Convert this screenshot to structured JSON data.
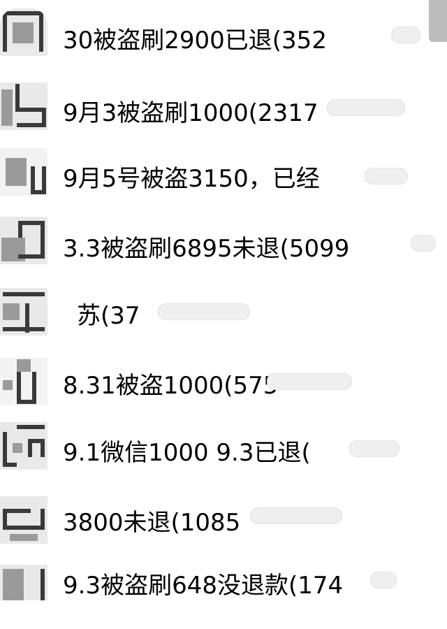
{
  "contacts": [
    {
      "name": "30被盗刷2900已退(352"
    },
    {
      "name": "9月3被盗刷1000(2317"
    },
    {
      "name": "9月5号被盗3150，已经"
    },
    {
      "name": "3.3被盗刷6895未退(5099"
    },
    {
      "name": "苏(37"
    },
    {
      "name": "8.31被盗1000(575"
    },
    {
      "name": "9.1微信1000   9.3已退("
    },
    {
      "name": "3800未退(1085"
    },
    {
      "name": "9.3被盗刷648没退款(174"
    }
  ]
}
